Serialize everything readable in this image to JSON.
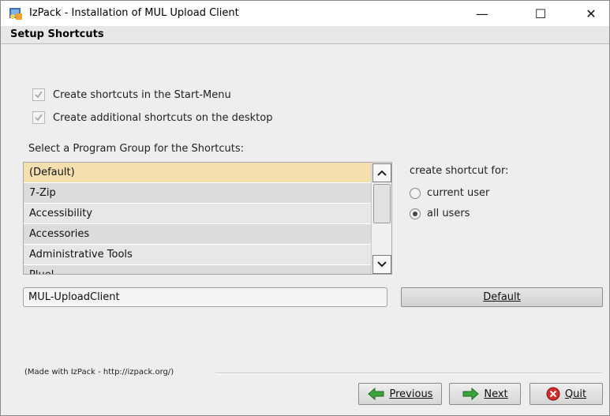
{
  "window": {
    "title": "IzPack - Installation of  MUL Upload Client",
    "controls": {
      "minimize": "—",
      "maximize": "☐",
      "close": "✕"
    }
  },
  "panel": {
    "title": "Setup Shortcuts"
  },
  "checkboxes": [
    {
      "label": "Create shortcuts in the Start-Menu",
      "checked": true,
      "enabled": false
    },
    {
      "label": "Create additional shortcuts on the desktop",
      "checked": true,
      "enabled": false
    }
  ],
  "program_group": {
    "label": "Select a Program Group for the Shortcuts:",
    "items": [
      "(Default)",
      "7-Zip",
      "Accessibility",
      "Accessories",
      "Administrative Tools",
      "Pluel"
    ],
    "selected_index": 0,
    "field_value": "MUL-UploadClient",
    "default_button": "Default"
  },
  "shortcut_for": {
    "label": "create shortcut for:",
    "options": [
      {
        "label": "current user",
        "selected": false
      },
      {
        "label": "all users",
        "selected": true
      }
    ]
  },
  "footer": {
    "made_with": "(Made with IzPack - http://izpack.org/)",
    "previous": "Previous",
    "next": "Next",
    "quit": "Quit"
  },
  "colors": {
    "selected_row": "#f6dfae",
    "arrow_green": "#3aa33a",
    "quit_red": "#d52b2b"
  }
}
